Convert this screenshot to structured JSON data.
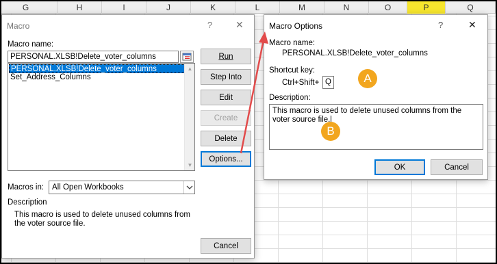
{
  "spreadsheet": {
    "columns": [
      "G",
      "H",
      "I",
      "J",
      "K",
      "L",
      "M",
      "N",
      "O",
      "P",
      "Q"
    ],
    "selected_column": "P",
    "selected_color": "#f7e62d"
  },
  "macro_dialog": {
    "title": "Macro",
    "help_glyph": "?",
    "close_glyph": "✕",
    "macro_name_label": "Macro name:",
    "macro_name_value": "PERSONAL.XLSB!Delete_voter_columns",
    "macro_list": [
      "PERSONAL.XLSB!Delete_voter_columns",
      "Set_Address_Columns"
    ],
    "buttons": {
      "run": "Run",
      "step_into": "Step Into",
      "edit": "Edit",
      "create": "Create",
      "delete": "Delete",
      "options": "Options...",
      "cancel": "Cancel"
    },
    "macros_in_label": "Macros in:",
    "macros_in_value": "All Open Workbooks",
    "description_label": "Description",
    "description_text": "This macro is used to delete unused columns from the voter source file."
  },
  "options_dialog": {
    "title": "Macro Options",
    "help_glyph": "?",
    "close_glyph": "✕",
    "macro_name_label": "Macro name:",
    "macro_name_value": "PERSONAL.XLSB!Delete_voter_columns",
    "shortcut_key_label": "Shortcut key:",
    "shortcut_prefix": "Ctrl+Shift+",
    "shortcut_value": "Q",
    "description_label": "Description:",
    "description_value": "This macro is used to delete unused columns from the voter source file.",
    "buttons": {
      "ok": "OK",
      "cancel": "Cancel"
    }
  },
  "annotations": {
    "badge_a": "A",
    "badge_b": "B",
    "badge_color": "#f2a61f",
    "arrow_color": "#e24b4b"
  }
}
